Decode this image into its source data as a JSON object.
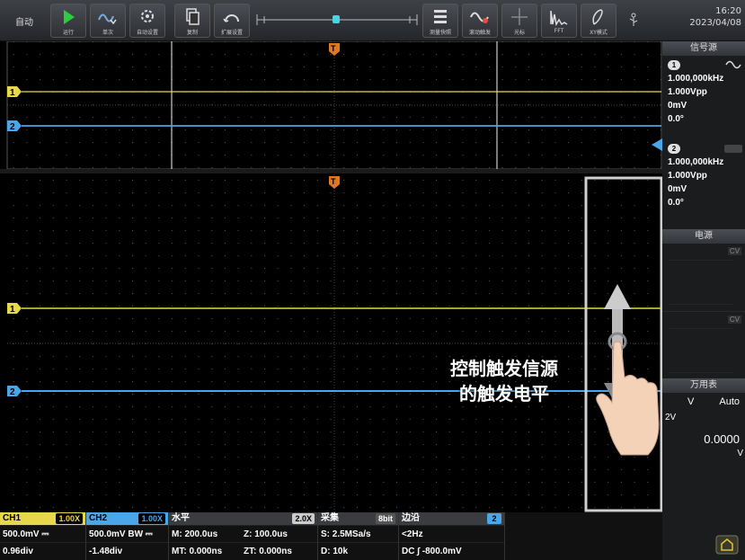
{
  "toolbar": {
    "mode": "自动",
    "buttons": [
      {
        "label": "运行",
        "icon": "play-icon"
      },
      {
        "label": "单次",
        "icon": "single-trigger-icon"
      },
      {
        "label": "自动设置",
        "icon": "auto-setup-icon"
      },
      {
        "label": "复制",
        "icon": "copy-icon"
      },
      {
        "label": "扩展设置",
        "icon": "extended-settings-icon"
      },
      {
        "label": "测量快照",
        "icon": "measure-snapshot-icon"
      },
      {
        "label": "滚动触发",
        "icon": "roll-trigger-icon"
      },
      {
        "label": "光标",
        "icon": "cursor-icon"
      },
      {
        "label": "FFT",
        "icon": "fft-icon"
      },
      {
        "label": "XY模式",
        "icon": "xy-mode-icon"
      }
    ],
    "time": "16:20",
    "date": "2023/04/08"
  },
  "right_panel": {
    "signal_header": "信号源",
    "sig1": {
      "num": "1",
      "freq": "1.000,000kHz",
      "amp": "1.000Vpp",
      "offset": "0mV",
      "phase": "0.0°"
    },
    "sig2": {
      "num": "2",
      "freq": "1.000,000kHz",
      "amp": "1.000Vpp",
      "offset": "0mV",
      "phase": "0.0°"
    },
    "power_header": "电源",
    "cv_label": "CV",
    "meter_header": "万用表",
    "meter_mode": "V",
    "meter_auto": "Auto",
    "meter_range": "2V",
    "meter_value": "0.0000",
    "meter_unit": "V"
  },
  "bottom": {
    "ch1": {
      "label": "CH1",
      "probe": "1.00X",
      "scale": "500.0mV ⎓",
      "pos": "0.96div"
    },
    "ch2": {
      "label": "CH2",
      "probe": "1.00X",
      "scale": "500.0mV BW ⎓",
      "pos": "-1.48div"
    },
    "horizontal": {
      "label": "水平",
      "zoom": "2.0X",
      "m": "M: 200.0us",
      "z": "Z: 100.0us",
      "mt": "MT: 0.000ns",
      "zt": "ZT: 0.000ns"
    },
    "acquire": {
      "label": "采集",
      "bits": "8bit",
      "rate": "S: 2.5MSa/s",
      "depth": "D: 10k"
    },
    "trigger": {
      "label": "边沿",
      "src": "2",
      "freq": "<2Hz",
      "coupling": "DC ∫ -800.0mV"
    }
  },
  "callout": {
    "line1": "控制触发信源",
    "line2": "的触发电平"
  },
  "colors": {
    "ch1": "#e6d84a",
    "ch2": "#4aa6e8",
    "accent": "#2b7fd8"
  }
}
